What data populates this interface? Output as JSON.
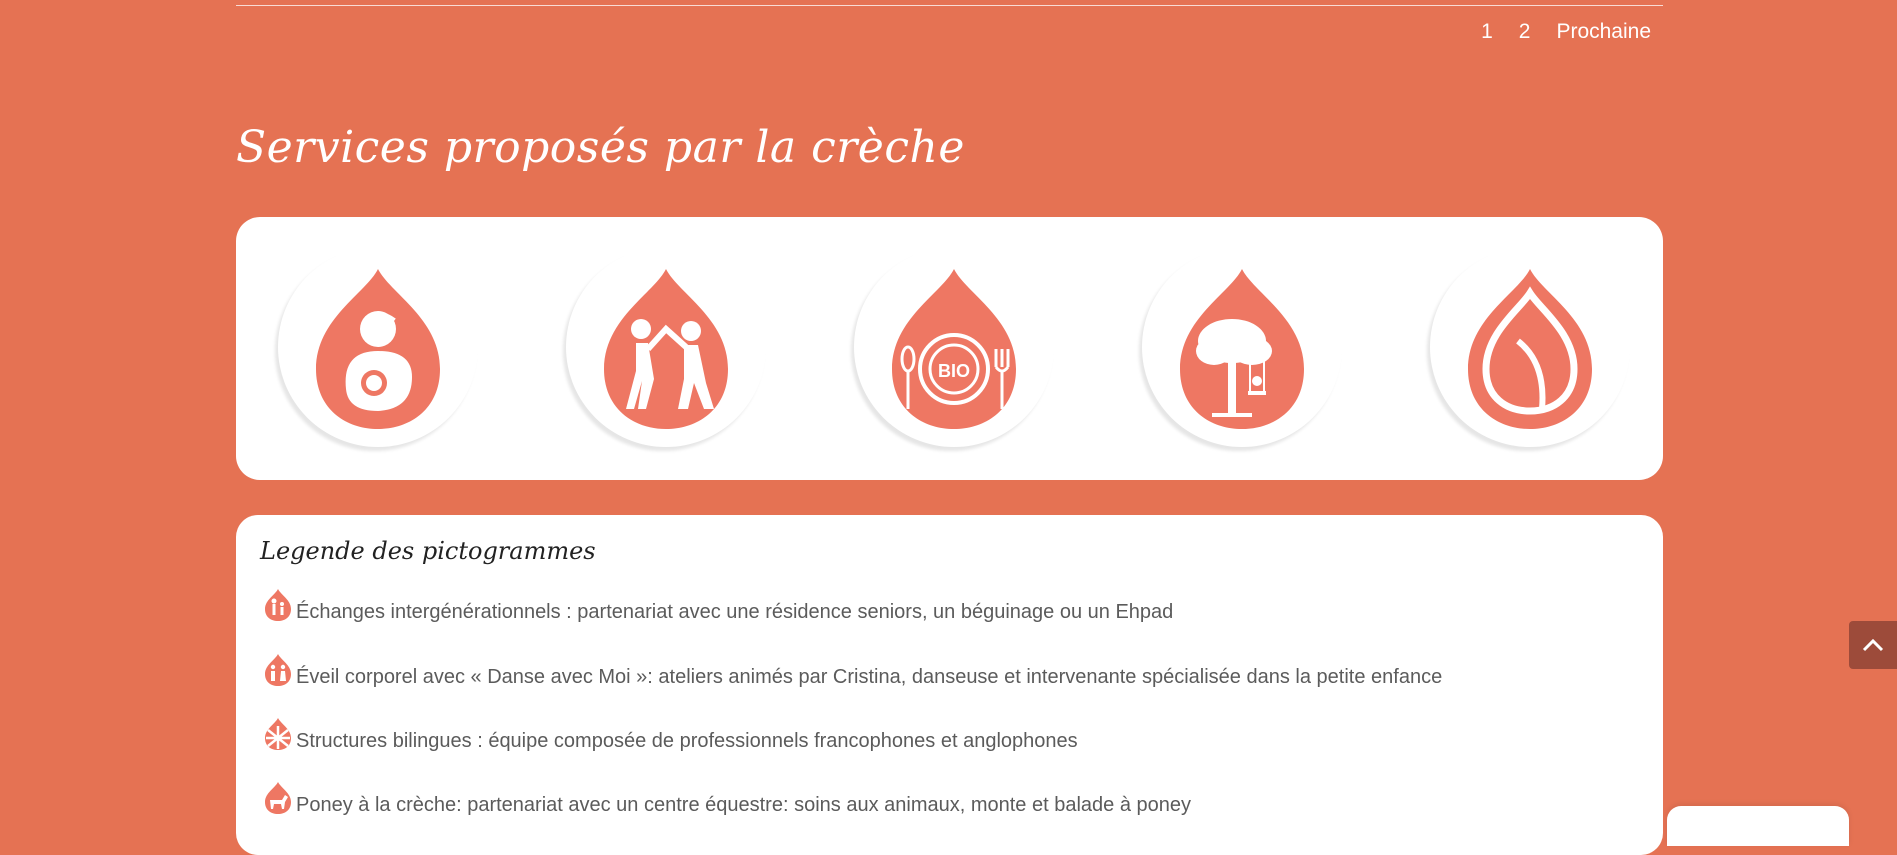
{
  "pagination": {
    "page1": "1",
    "page2": "2",
    "next": "Prochaine"
  },
  "services": {
    "title": "Services proposés par la crèche",
    "icons": [
      "breastfeeding-icon",
      "dance-icon",
      "organic-meal-icon",
      "tree-swing-icon",
      "leaf-icon"
    ]
  },
  "legend": {
    "title": "Legende des pictogrammes",
    "items": [
      {
        "icon": "intergenerational-icon",
        "text": "Échanges intergénérationnels : partenariat avec une résidence seniors, un béguinage ou un Ehpad"
      },
      {
        "icon": "dance-icon",
        "text": "Éveil corporel avec «  Danse avec Moi »: ateliers animés par Cristina, danseuse et intervenante spécialisée dans la petite enfance"
      },
      {
        "icon": "uk-flag-icon",
        "text": "Structures bilingues : équipe composée de professionnels francophones et anglophones"
      },
      {
        "icon": "pony-icon",
        "text": "Poney à la crèche: partenariat avec un centre équestre: soins aux animaux, monte et balade à poney"
      }
    ]
  },
  "colors": {
    "background": "#e57253",
    "drop": "#ee7763",
    "scroll_button": "#9d4b3a"
  }
}
